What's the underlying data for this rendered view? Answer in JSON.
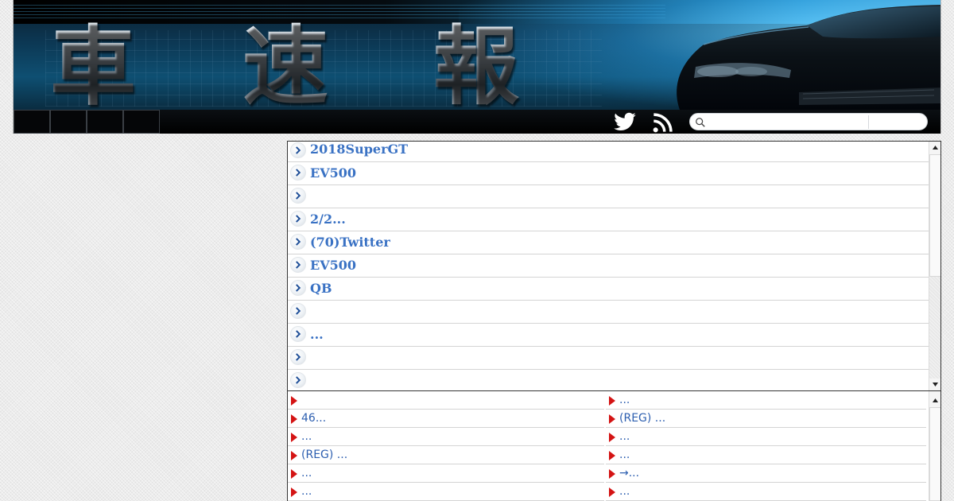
{
  "header": {
    "logo_chars": [
      "車",
      "速",
      "報"
    ],
    "nav_items": [
      "",
      "",
      "",
      ""
    ],
    "search": {
      "placeholder": "",
      "value": ""
    }
  },
  "icons": {
    "twitter": "twitter-bird-icon",
    "rss": "rss-feed-icon",
    "search": "magnifier-icon",
    "list_bullet": "chevron-right-icon",
    "grid_bullet": "red-triangle-icon"
  },
  "colors": {
    "link_blue": "#3a72c4",
    "bullet_red": "#d41414",
    "banner_blue": "#2a9ad6"
  },
  "headline_list": [
    {
      "label": "2018SuperGT"
    },
    {
      "label": "EV500"
    },
    {
      "label": ""
    },
    {
      "label": "2/2..."
    },
    {
      "label": "(70)Twitter"
    },
    {
      "label": "EV500"
    },
    {
      "label": "QB"
    },
    {
      "label": ""
    },
    {
      "label": "..."
    },
    {
      "label": ""
    },
    {
      "label": ""
    }
  ],
  "link_grid": [
    {
      "left": "",
      "right": "..."
    },
    {
      "left": "46...",
      "right": "(REG) ..."
    },
    {
      "left": "...",
      "right": "..."
    },
    {
      "left": "(REG) ...",
      "right": "..."
    },
    {
      "left": "...",
      "right": "→..."
    },
    {
      "left": "...",
      "right": "..."
    }
  ]
}
